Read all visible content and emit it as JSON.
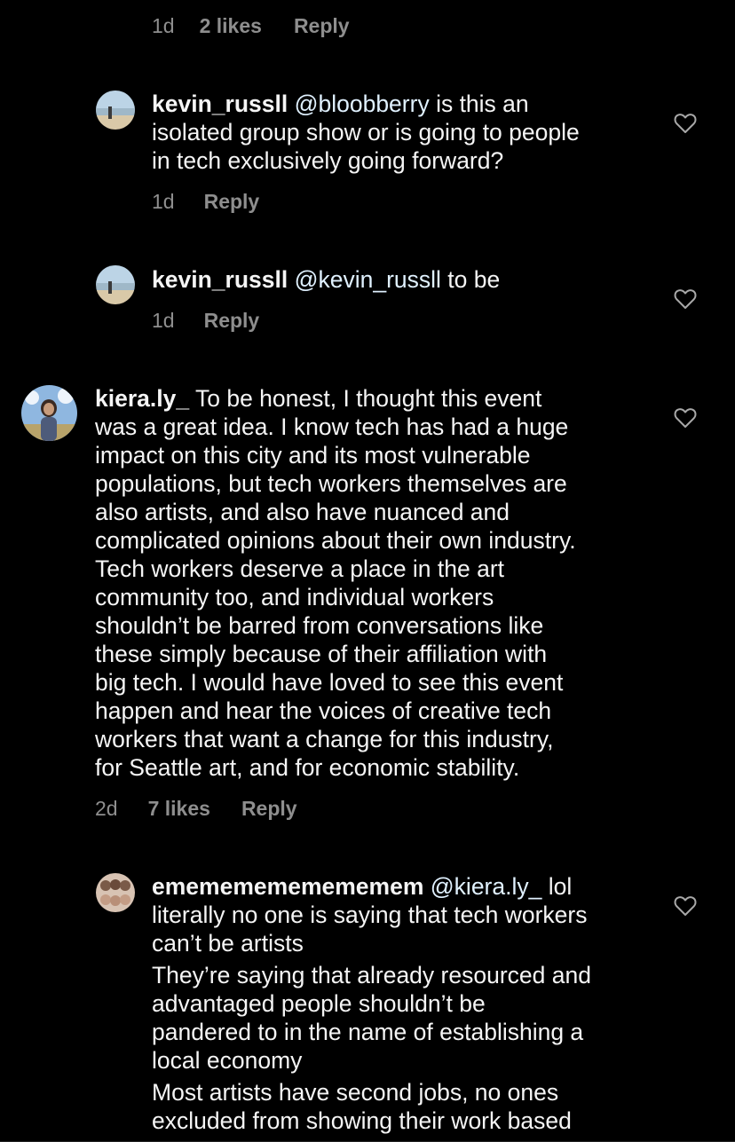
{
  "top_meta": {
    "time": "1d",
    "likes": "2 likes",
    "reply": "Reply"
  },
  "comments": [
    {
      "username": "kevin_russll",
      "mention": "@bloobberry",
      "lines": [
        " is this an",
        "isolated group show or is going to people",
        "in tech exclusively going forward?"
      ],
      "time": "1d",
      "reply": "Reply"
    },
    {
      "username": "kevin_russll",
      "mention": "@kevin_russll",
      "lines": [
        " to be"
      ],
      "time": "1d",
      "reply": "Reply"
    },
    {
      "username": "kiera.ly_",
      "lines": [
        " To be honest, I thought this event",
        "was a great idea. I know tech has had a huge",
        "impact on this city and its most vulnerable",
        "populations, but tech workers themselves are",
        "also artists, and also have nuanced and",
        "complicated opinions about their own industry.",
        "Tech workers deserve a place in the art",
        "community too, and individual workers",
        "shouldn’t be barred from conversations like",
        "these simply because of their affiliation with",
        "big tech. I would have loved to see this event",
        "happen and hear the voices of creative tech",
        "workers that want a change for this industry,",
        "for Seattle art, and for economic stability."
      ],
      "time": "2d",
      "likes": "7 likes",
      "reply": "Reply"
    },
    {
      "username": "emememememememem",
      "mention": "@kiera.ly_",
      "lines": [
        " lol",
        "literally no one is saying that tech workers",
        "can’t be artists",
        "They’re saying that already resourced and",
        "advantaged people shouldn’t be",
        "pandered to in the name of establishing a",
        "local economy",
        "Most artists have second jobs, no ones",
        "excluded from showing their work based"
      ]
    }
  ],
  "icons": {
    "like": "heart-icon"
  },
  "colors": {
    "background": "#000000",
    "text": "#f5f5f5",
    "meta": "#8e8e8e",
    "mention": "#e0f1ff"
  }
}
